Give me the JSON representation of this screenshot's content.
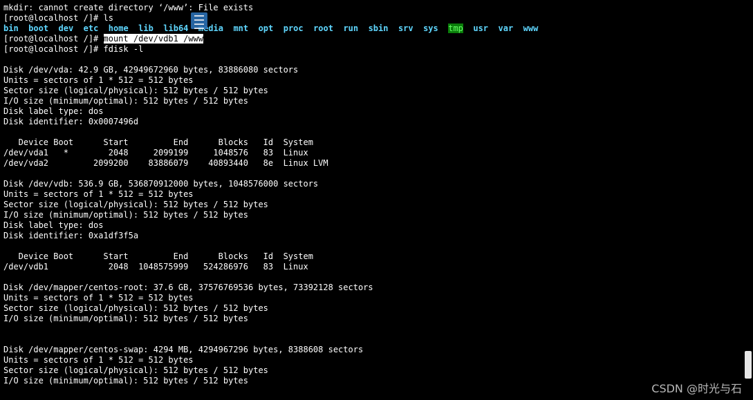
{
  "terminal": {
    "lines": [
      {
        "type": "text",
        "text": "mkdir: cannot create directory ‘/www’: File exists"
      },
      {
        "type": "text",
        "text": "[root@localhost /]# ls"
      },
      {
        "type": "ls",
        "dirs": [
          {
            "name": "bin",
            "style": "dir"
          },
          {
            "name": "boot",
            "style": "dir"
          },
          {
            "name": "dev",
            "style": "dir"
          },
          {
            "name": "etc",
            "style": "dir"
          },
          {
            "name": "home",
            "style": "dir"
          },
          {
            "name": "lib",
            "style": "dir"
          },
          {
            "name": "lib64",
            "style": "dir"
          },
          {
            "name": "media",
            "style": "dir"
          },
          {
            "name": "mnt",
            "style": "dir"
          },
          {
            "name": "opt",
            "style": "dir"
          },
          {
            "name": "proc",
            "style": "dir"
          },
          {
            "name": "root",
            "style": "dir"
          },
          {
            "name": "run",
            "style": "dir"
          },
          {
            "name": "sbin",
            "style": "dir"
          },
          {
            "name": "srv",
            "style": "dir"
          },
          {
            "name": "sys",
            "style": "dir"
          },
          {
            "name": "tmp",
            "style": "tmp"
          },
          {
            "name": "usr",
            "style": "dir"
          },
          {
            "name": "var",
            "style": "dir"
          },
          {
            "name": "www",
            "style": "dir"
          }
        ]
      },
      {
        "type": "selected",
        "prefix": "[root@localhost /]# ",
        "selected": "mount /dev/vdb1 /www"
      },
      {
        "type": "text",
        "text": "[root@localhost /]# fdisk -l"
      },
      {
        "type": "text",
        "text": ""
      },
      {
        "type": "text",
        "text": "Disk /dev/vda: 42.9 GB, 42949672960 bytes, 83886080 sectors"
      },
      {
        "type": "text",
        "text": "Units = sectors of 1 * 512 = 512 bytes"
      },
      {
        "type": "text",
        "text": "Sector size (logical/physical): 512 bytes / 512 bytes"
      },
      {
        "type": "text",
        "text": "I/O size (minimum/optimal): 512 bytes / 512 bytes"
      },
      {
        "type": "text",
        "text": "Disk label type: dos"
      },
      {
        "type": "text",
        "text": "Disk identifier: 0x0007496d"
      },
      {
        "type": "text",
        "text": ""
      },
      {
        "type": "text",
        "text": "   Device Boot      Start         End      Blocks   Id  System"
      },
      {
        "type": "text",
        "text": "/dev/vda1   *        2048     2099199     1048576   83  Linux"
      },
      {
        "type": "text",
        "text": "/dev/vda2         2099200    83886079    40893440   8e  Linux LVM"
      },
      {
        "type": "text",
        "text": ""
      },
      {
        "type": "text",
        "text": "Disk /dev/vdb: 536.9 GB, 536870912000 bytes, 1048576000 sectors"
      },
      {
        "type": "text",
        "text": "Units = sectors of 1 * 512 = 512 bytes"
      },
      {
        "type": "text",
        "text": "Sector size (logical/physical): 512 bytes / 512 bytes"
      },
      {
        "type": "text",
        "text": "I/O size (minimum/optimal): 512 bytes / 512 bytes"
      },
      {
        "type": "text",
        "text": "Disk label type: dos"
      },
      {
        "type": "text",
        "text": "Disk identifier: 0xa1df3f5a"
      },
      {
        "type": "text",
        "text": ""
      },
      {
        "type": "text",
        "text": "   Device Boot      Start         End      Blocks   Id  System"
      },
      {
        "type": "text",
        "text": "/dev/vdb1            2048  1048575999   524286976   83  Linux"
      },
      {
        "type": "text",
        "text": ""
      },
      {
        "type": "text",
        "text": "Disk /dev/mapper/centos-root: 37.6 GB, 37576769536 bytes, 73392128 sectors"
      },
      {
        "type": "text",
        "text": "Units = sectors of 1 * 512 = 512 bytes"
      },
      {
        "type": "text",
        "text": "Sector size (logical/physical): 512 bytes / 512 bytes"
      },
      {
        "type": "text",
        "text": "I/O size (minimum/optimal): 512 bytes / 512 bytes"
      },
      {
        "type": "text",
        "text": ""
      },
      {
        "type": "text",
        "text": ""
      },
      {
        "type": "text",
        "text": "Disk /dev/mapper/centos-swap: 4294 MB, 4294967296 bytes, 8388608 sectors"
      },
      {
        "type": "text",
        "text": "Units = sectors of 1 * 512 = 512 bytes"
      },
      {
        "type": "text",
        "text": "Sector size (logical/physical): 512 bytes / 512 bytes"
      },
      {
        "type": "text",
        "text": "I/O size (minimum/optimal): 512 bytes / 512 bytes"
      }
    ]
  },
  "watermark": "CSDN @时光与石",
  "overlay_icon": "document-list-icon",
  "colors": {
    "background": "#000000",
    "text": "#ffffff",
    "directory": "#5fd7ff",
    "tmp_bg": "#0a7d0a",
    "tmp_fg": "#66ff66",
    "selection_bg": "#ffffff"
  }
}
